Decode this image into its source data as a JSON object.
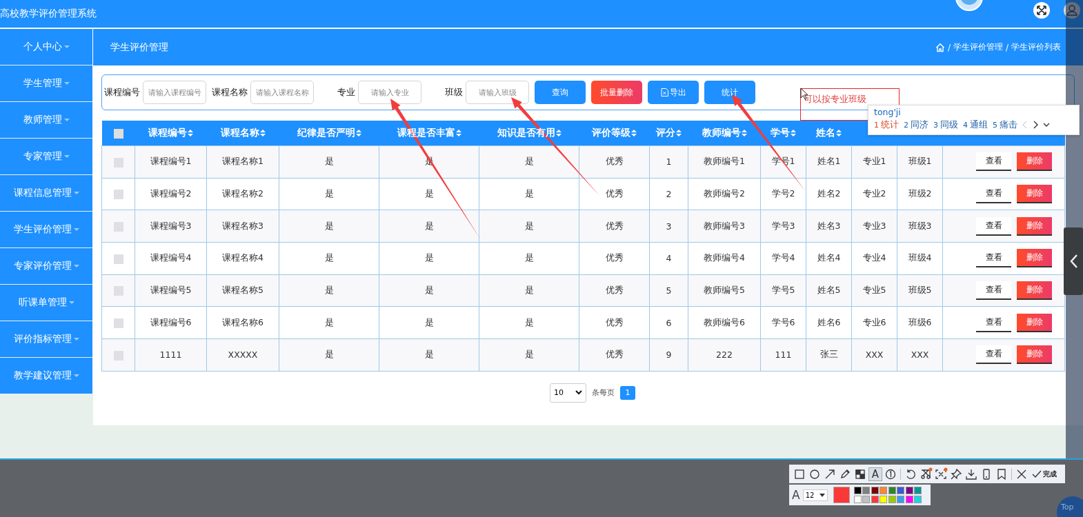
{
  "app": {
    "title": "高校教学评价管理系统"
  },
  "sidebar": {
    "items": [
      {
        "label": "个人中心"
      },
      {
        "label": "学生管理"
      },
      {
        "label": "教师管理"
      },
      {
        "label": "专家管理"
      },
      {
        "label": "课程信息管理"
      },
      {
        "label": "学生评价管理"
      },
      {
        "label": "专家评价管理"
      },
      {
        "label": "听课单管理"
      },
      {
        "label": "评价指标管理"
      },
      {
        "label": "教学建议管理"
      }
    ]
  },
  "page": {
    "title": "学生评价管理",
    "breadcrumb": [
      {
        "separator": "/",
        "label": "学生评价管理"
      },
      {
        "separator": "/",
        "label": "学生评价列表"
      }
    ]
  },
  "search": {
    "fields": [
      {
        "label": "课程编号",
        "placeholder": "请输入课程编号"
      },
      {
        "label": "课程名称",
        "placeholder": "请输入课程名称"
      },
      {
        "label": "专业",
        "placeholder": "请输入专业"
      },
      {
        "label": "班级",
        "placeholder": "请输入班级"
      }
    ],
    "buttons": [
      {
        "label": "查询",
        "kind": "primary"
      },
      {
        "label": "批量删除",
        "kind": "danger"
      },
      {
        "label": "导出",
        "kind": "export"
      },
      {
        "label": "统计",
        "kind": "primary"
      }
    ]
  },
  "table": {
    "header_checked": false,
    "columns": [
      {
        "label": "课程编号",
        "sortable": true
      },
      {
        "label": "课程名称",
        "sortable": true
      },
      {
        "label": "纪律是否严明",
        "sortable": true
      },
      {
        "label": "课程是否丰富",
        "sortable": true
      },
      {
        "label": "知识是否有用",
        "sortable": true
      },
      {
        "label": "评价等级",
        "sortable": true
      },
      {
        "label": "评分",
        "sortable": true
      },
      {
        "label": "教师编号",
        "sortable": true
      },
      {
        "label": "学号",
        "sortable": true
      },
      {
        "label": "姓名",
        "sortable": true
      }
    ],
    "rows": [
      {
        "checked": false,
        "cells": [
          "课程编号1",
          "课程名称1",
          "是",
          "是",
          "是",
          "优秀",
          "1",
          "教师编号1",
          "学号1",
          "姓名1",
          "专业1",
          "班级1"
        ],
        "actions": [
          "查看",
          "删除"
        ]
      },
      {
        "checked": false,
        "cells": [
          "课程编号2",
          "课程名称2",
          "是",
          "是",
          "是",
          "优秀",
          "2",
          "教师编号2",
          "学号2",
          "姓名2",
          "专业2",
          "班级2"
        ],
        "actions": [
          "查看",
          "删除"
        ]
      },
      {
        "checked": false,
        "cells": [
          "课程编号3",
          "课程名称3",
          "是",
          "是",
          "是",
          "优秀",
          "3",
          "教师编号3",
          "学号3",
          "姓名3",
          "专业3",
          "班级3"
        ],
        "actions": [
          "查看",
          "删除"
        ]
      },
      {
        "checked": false,
        "cells": [
          "课程编号4",
          "课程名称4",
          "是",
          "是",
          "是",
          "优秀",
          "4",
          "教师编号4",
          "学号4",
          "姓名4",
          "专业4",
          "班级4"
        ],
        "actions": [
          "查看",
          "删除"
        ]
      },
      {
        "checked": false,
        "cells": [
          "课程编号5",
          "课程名称5",
          "是",
          "是",
          "是",
          "优秀",
          "5",
          "教师编号5",
          "学号5",
          "姓名5",
          "专业5",
          "班级5"
        ],
        "actions": [
          "查看",
          "删除"
        ]
      },
      {
        "checked": false,
        "cells": [
          "课程编号6",
          "课程名称6",
          "是",
          "是",
          "是",
          "优秀",
          "6",
          "教师编号6",
          "学号6",
          "姓名6",
          "专业6",
          "班级6"
        ],
        "actions": [
          "查看",
          "删除"
        ]
      },
      {
        "checked": false,
        "cells": [
          "1111",
          "XXXXX",
          "是",
          "是",
          "是",
          "优秀",
          "9",
          "222",
          "111",
          "张三",
          "XXX",
          "XXX"
        ],
        "actions": [
          "查看",
          "删除"
        ]
      }
    ]
  },
  "pagination": {
    "page_size": "10",
    "unit": "条每页",
    "pages": [
      {
        "label": "1",
        "selected": true
      }
    ]
  },
  "annotation": {
    "note": "可以按专业班级"
  },
  "ime": {
    "input": "tong'ji",
    "candidates": [
      {
        "index": "1",
        "text": "统计",
        "selected": true
      },
      {
        "index": "2",
        "text": "同济",
        "selected": false
      },
      {
        "index": "3",
        "text": "同级",
        "selected": false
      },
      {
        "index": "4",
        "text": "通组",
        "selected": false
      },
      {
        "index": "5",
        "text": "痛击",
        "selected": false
      }
    ]
  },
  "capture_toolbar": {
    "tools": [
      {
        "kind": "rectangle",
        "selected": false
      },
      {
        "kind": "ellipse",
        "selected": false
      },
      {
        "kind": "arrow",
        "selected": false
      },
      {
        "kind": "pen",
        "selected": false
      },
      {
        "kind": "mosaic",
        "selected": false
      },
      {
        "kind": "text",
        "label": "A",
        "selected": true
      },
      {
        "kind": "counter",
        "selected": false
      },
      {
        "kind": "separator"
      },
      {
        "kind": "undo",
        "selected": false
      },
      {
        "kind": "scissors",
        "selected": false
      },
      {
        "kind": "scan",
        "selected": false
      },
      {
        "kind": "pin",
        "selected": false
      },
      {
        "kind": "download",
        "selected": false
      },
      {
        "kind": "phone",
        "selected": false
      },
      {
        "kind": "bookmark",
        "selected": false
      },
      {
        "kind": "separator"
      },
      {
        "kind": "close",
        "selected": false
      }
    ],
    "done": "完成",
    "font_icon": "A",
    "font_size": "12",
    "current": {
      "color": "#fb3838"
    },
    "palette": [
      {
        "color": "#000000"
      },
      {
        "color": "#808080"
      },
      {
        "color": "#800000"
      },
      {
        "color": "#f7883a"
      },
      {
        "color": "#308430"
      },
      {
        "color": "#385ad3"
      },
      {
        "color": "#800080"
      },
      {
        "color": "#009999"
      },
      {
        "color": "#ffffff"
      },
      {
        "color": "#c0c0c0"
      },
      {
        "color": "#fb3838"
      },
      {
        "color": "#ffff00"
      },
      {
        "color": "#99cc00"
      },
      {
        "color": "#3d9bef"
      },
      {
        "color": "#ff00ff"
      },
      {
        "color": "#1bd6e1"
      }
    ]
  },
  "back_to_top": {
    "label": "Top"
  }
}
